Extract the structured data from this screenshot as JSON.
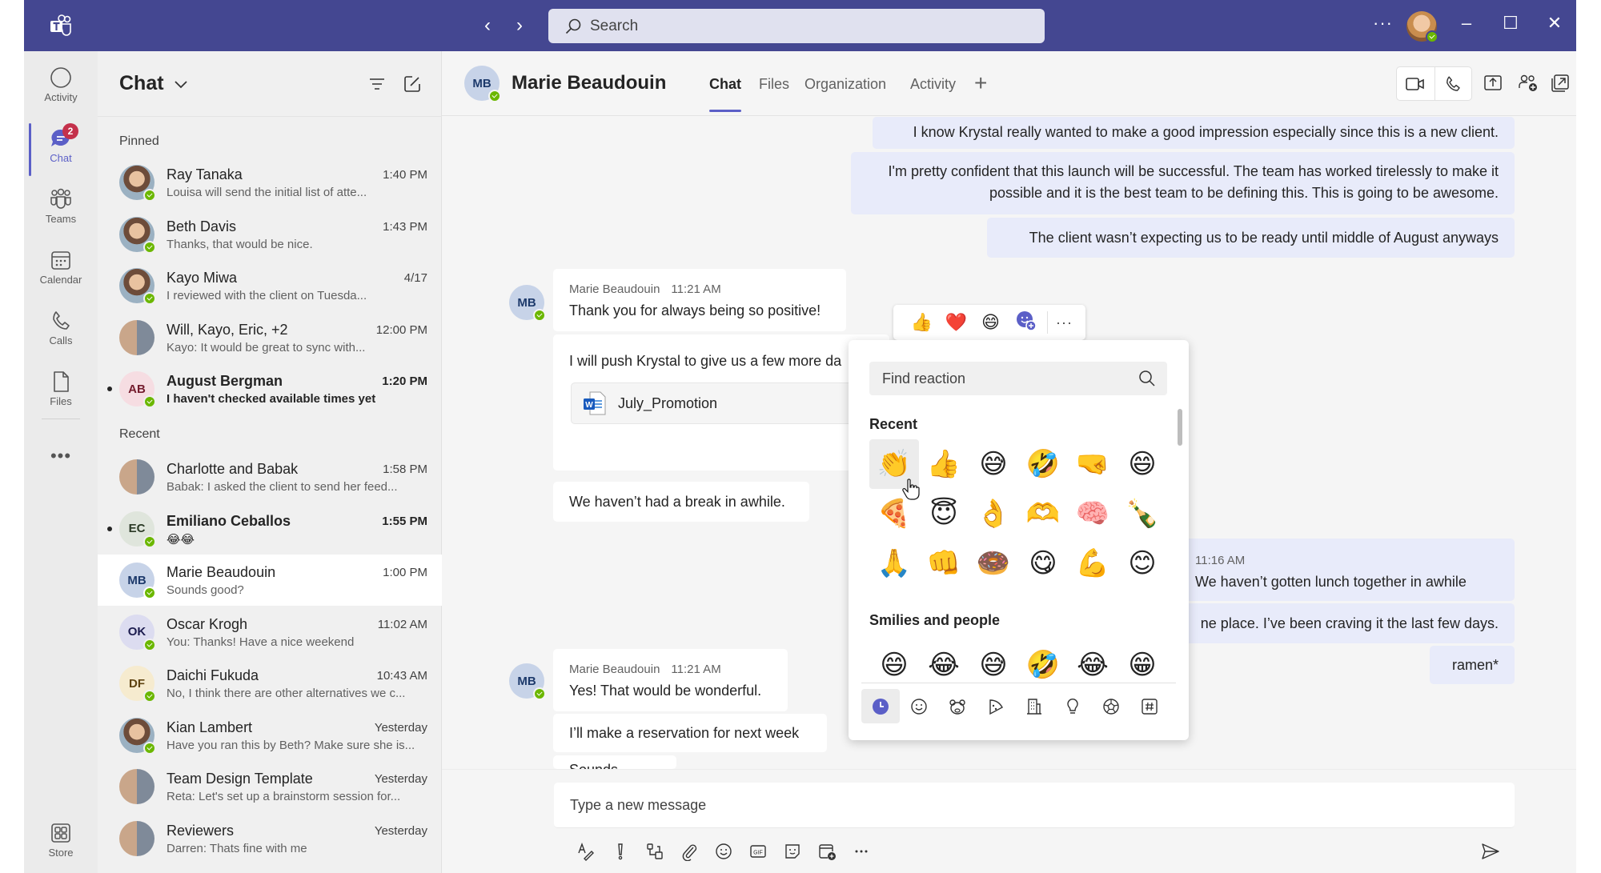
{
  "titlebar": {
    "app_icon": "teams-logo-icon",
    "search_placeholder": "Search",
    "more_label": "···",
    "window_controls": [
      "minimize",
      "maximize",
      "close"
    ]
  },
  "rail": {
    "items": [
      {
        "label": "Activity",
        "icon": "bell-icon",
        "active": false
      },
      {
        "label": "Chat",
        "icon": "chat-icon",
        "active": true,
        "badge": "2"
      },
      {
        "label": "Teams",
        "icon": "teams-icon",
        "active": false
      },
      {
        "label": "Calendar",
        "icon": "calendar-icon",
        "active": false
      },
      {
        "label": "Calls",
        "icon": "phone-icon",
        "active": false
      },
      {
        "label": "Files",
        "icon": "file-icon",
        "active": false
      }
    ],
    "more_label": "•••",
    "store_label": "Store"
  },
  "chatlist": {
    "title": "Chat",
    "pinned_label": "Pinned",
    "recent_label": "Recent",
    "pinned": [
      {
        "name": "Ray Tanaka",
        "time": "1:40 PM",
        "preview": "Louisa will send the initial list of atte...",
        "avatar": "photo",
        "presence": true,
        "unread": false
      },
      {
        "name": "Beth Davis",
        "time": "1:43 PM",
        "preview": "Thanks, that would be nice.",
        "avatar": "photo",
        "presence": true,
        "unread": false
      },
      {
        "name": "Kayo Miwa",
        "time": "4/17",
        "preview": "I reviewed with the client on Tuesda...",
        "avatar": "photo",
        "presence": true,
        "unread": false
      },
      {
        "name": "Will, Kayo, Eric, +2",
        "time": "12:00 PM",
        "preview": "Kayo: It would be great to sync with...",
        "avatar": "group",
        "presence": false,
        "unread": false
      },
      {
        "name": "August Bergman",
        "time": "1:20 PM",
        "preview": "I haven't checked available times yet",
        "avatar": "AB",
        "avatar_bg": "#f6dde2",
        "avatar_fg": "#751d2e",
        "presence": true,
        "unread": true
      }
    ],
    "recent": [
      {
        "name": "Charlotte and Babak",
        "time": "1:58 PM",
        "preview": "Babak: I asked the client to send her feed...",
        "avatar": "group",
        "presence": false,
        "unread": false
      },
      {
        "name": "Emiliano Ceballos",
        "time": "1:55 PM",
        "preview": "😂😂",
        "avatar": "EC",
        "avatar_bg": "#dfe5dc",
        "avatar_fg": "#2b3a26",
        "presence": true,
        "unread": true
      },
      {
        "name": "Marie Beaudouin",
        "time": "1:00 PM",
        "preview": "Sounds good?",
        "avatar": "MB",
        "avatar_bg": "#c7d3e8",
        "avatar_fg": "#1d3a6b",
        "presence": true,
        "unread": false,
        "selected": true
      },
      {
        "name": "Oscar Krogh",
        "time": "11:02 AM",
        "preview": "You: Thanks! Have a nice weekend",
        "avatar": "OK",
        "avatar_bg": "#dcdcf0",
        "avatar_fg": "#1c1c4f",
        "presence": true,
        "unread": false
      },
      {
        "name": "Daichi Fukuda",
        "time": "10:43 AM",
        "preview": "No, I think there are other alternatives we c...",
        "avatar": "DF",
        "avatar_bg": "#f6ebcf",
        "avatar_fg": "#5e4310",
        "presence": true,
        "unread": false
      },
      {
        "name": "Kian Lambert",
        "time": "Yesterday",
        "preview": "Have you ran this by Beth? Make sure she is...",
        "avatar": "photo",
        "presence": true,
        "unread": false
      },
      {
        "name": "Team Design Template",
        "time": "Yesterday",
        "preview": "Reta: Let's set up a brainstorm session for...",
        "avatar": "group",
        "presence": false,
        "unread": false
      },
      {
        "name": "Reviewers",
        "time": "Yesterday",
        "preview": "Darren: Thats fine with me",
        "avatar": "group",
        "presence": false,
        "unread": false
      }
    ]
  },
  "conversation": {
    "contact_initials": "MB",
    "contact_name": "Marie Beaudouin",
    "tabs": [
      {
        "label": "Chat",
        "active": true
      },
      {
        "label": "Files",
        "active": false
      },
      {
        "label": "Organization",
        "active": false
      },
      {
        "label": "Activity",
        "active": false
      }
    ],
    "add_tab_label": "+",
    "header_actions": [
      "video-call",
      "audio-call",
      "share-screen",
      "add-people",
      "pop-out"
    ],
    "messages_me_top": [
      "I know Krystal really wanted to make a good impression especially since this is a new client.",
      "I'm pretty confident that this launch will be successful. The team has worked tirelessly to make it possible and it is the best team to be defining this. This is going to be awesome.",
      "The client wasn’t expecting us to be ready until middle of August anyways"
    ],
    "group1": {
      "sender": "Marie Beaudouin",
      "time": "11:21 AM",
      "messages": [
        "Thank you for always being so positive!",
        "I will push Krystal to give us a few more da",
        "We haven’t had a break in awhile."
      ],
      "attachment": "July_Promotion"
    },
    "me_mid": {
      "time": "11:16 AM",
      "messages": [
        "We haven’t gotten lunch together in awhile",
        "ne place. I’ve been craving it the last few days.",
        "ramen*"
      ]
    },
    "group2": {
      "sender": "Marie Beaudouin",
      "time": "11:21 AM",
      "messages": [
        "Yes! That would be wonderful.",
        "I’ll make a reservation for next week",
        "Sounds good?"
      ]
    },
    "compose_placeholder": "Type a new message",
    "compose_tools": [
      "format",
      "important",
      "loop",
      "attach",
      "emoji",
      "gif",
      "sticker",
      "schedule-meeting",
      "more"
    ]
  },
  "reaction_bar": {
    "reactions": [
      "👍",
      "❤️",
      "😄"
    ],
    "more_label": "···"
  },
  "emoji_picker": {
    "search_placeholder": "Find reaction",
    "recent_label": "Recent",
    "recent": [
      "👏",
      "👍",
      "😅",
      "🤣",
      "🤜",
      "😄",
      "🍕",
      "😇",
      "👌",
      "🫶",
      "🧠",
      "🍾",
      "🙏",
      "👊",
      "🍩",
      "😋",
      "💪",
      "😊"
    ],
    "smilies_label": "Smilies and people",
    "smilies": [
      "😄",
      "😂",
      "😅",
      "🤣",
      "😂",
      "😁"
    ],
    "category_tabs": [
      "recent",
      "smileys",
      "animals",
      "food",
      "places",
      "objects",
      "activities",
      "symbols"
    ],
    "accent": "#5b5fc7"
  },
  "colors": {
    "titlebar": "#444791",
    "accent": "#5b5fc7",
    "presence": "#6bb700",
    "badge": "#c4314b",
    "my_bubble": "#e8ebfa"
  }
}
